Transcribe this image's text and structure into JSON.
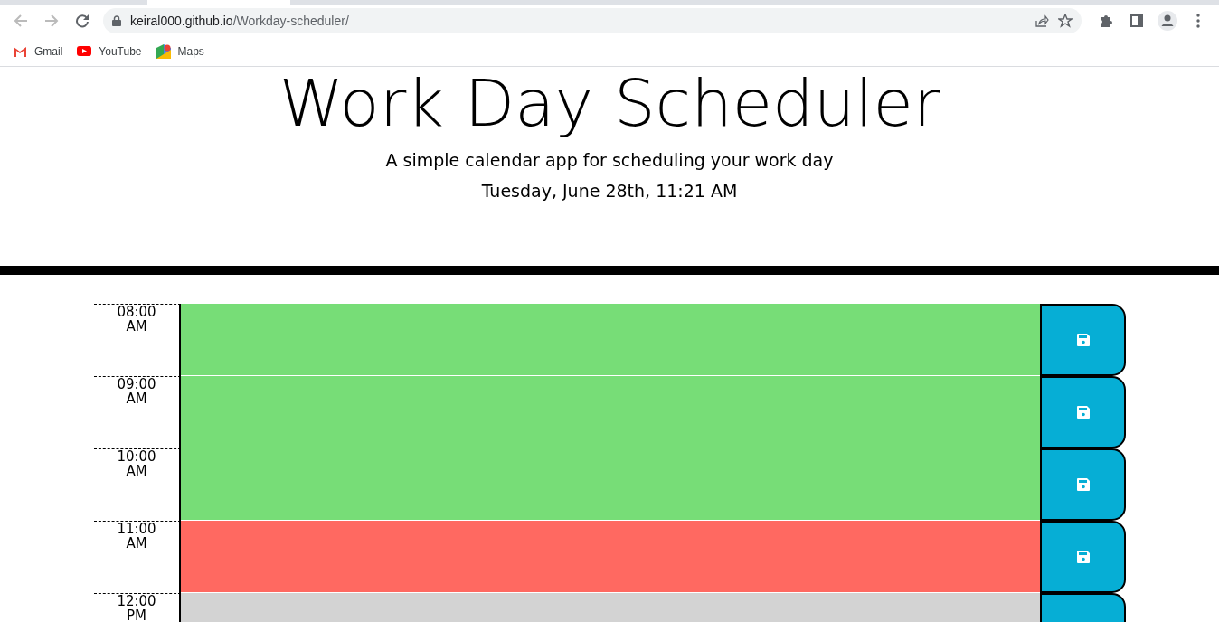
{
  "browser": {
    "url_host": "keiral000.github.io",
    "url_path": "/Workday-scheduler/",
    "bookmarks": [
      {
        "label": "Gmail",
        "kind": "gmail"
      },
      {
        "label": "YouTube",
        "kind": "youtube"
      },
      {
        "label": "Maps",
        "kind": "maps"
      }
    ]
  },
  "header": {
    "title": "Work Day Scheduler",
    "subtitle": "A simple calendar app for scheduling your work day",
    "current_day": "Tuesday, June 28th, 11:21 AM"
  },
  "hours": [
    {
      "hour": "08:00",
      "period": "AM",
      "color": "#77dd77"
    },
    {
      "hour": "09:00",
      "period": "AM",
      "color": "#77dd77"
    },
    {
      "hour": "10:00",
      "period": "AM",
      "color": "#77dd77"
    },
    {
      "hour": "11:00",
      "period": "AM",
      "color": "#ff6961"
    },
    {
      "hour": "12:00",
      "period": "PM",
      "color": "#d3d3d3"
    }
  ]
}
